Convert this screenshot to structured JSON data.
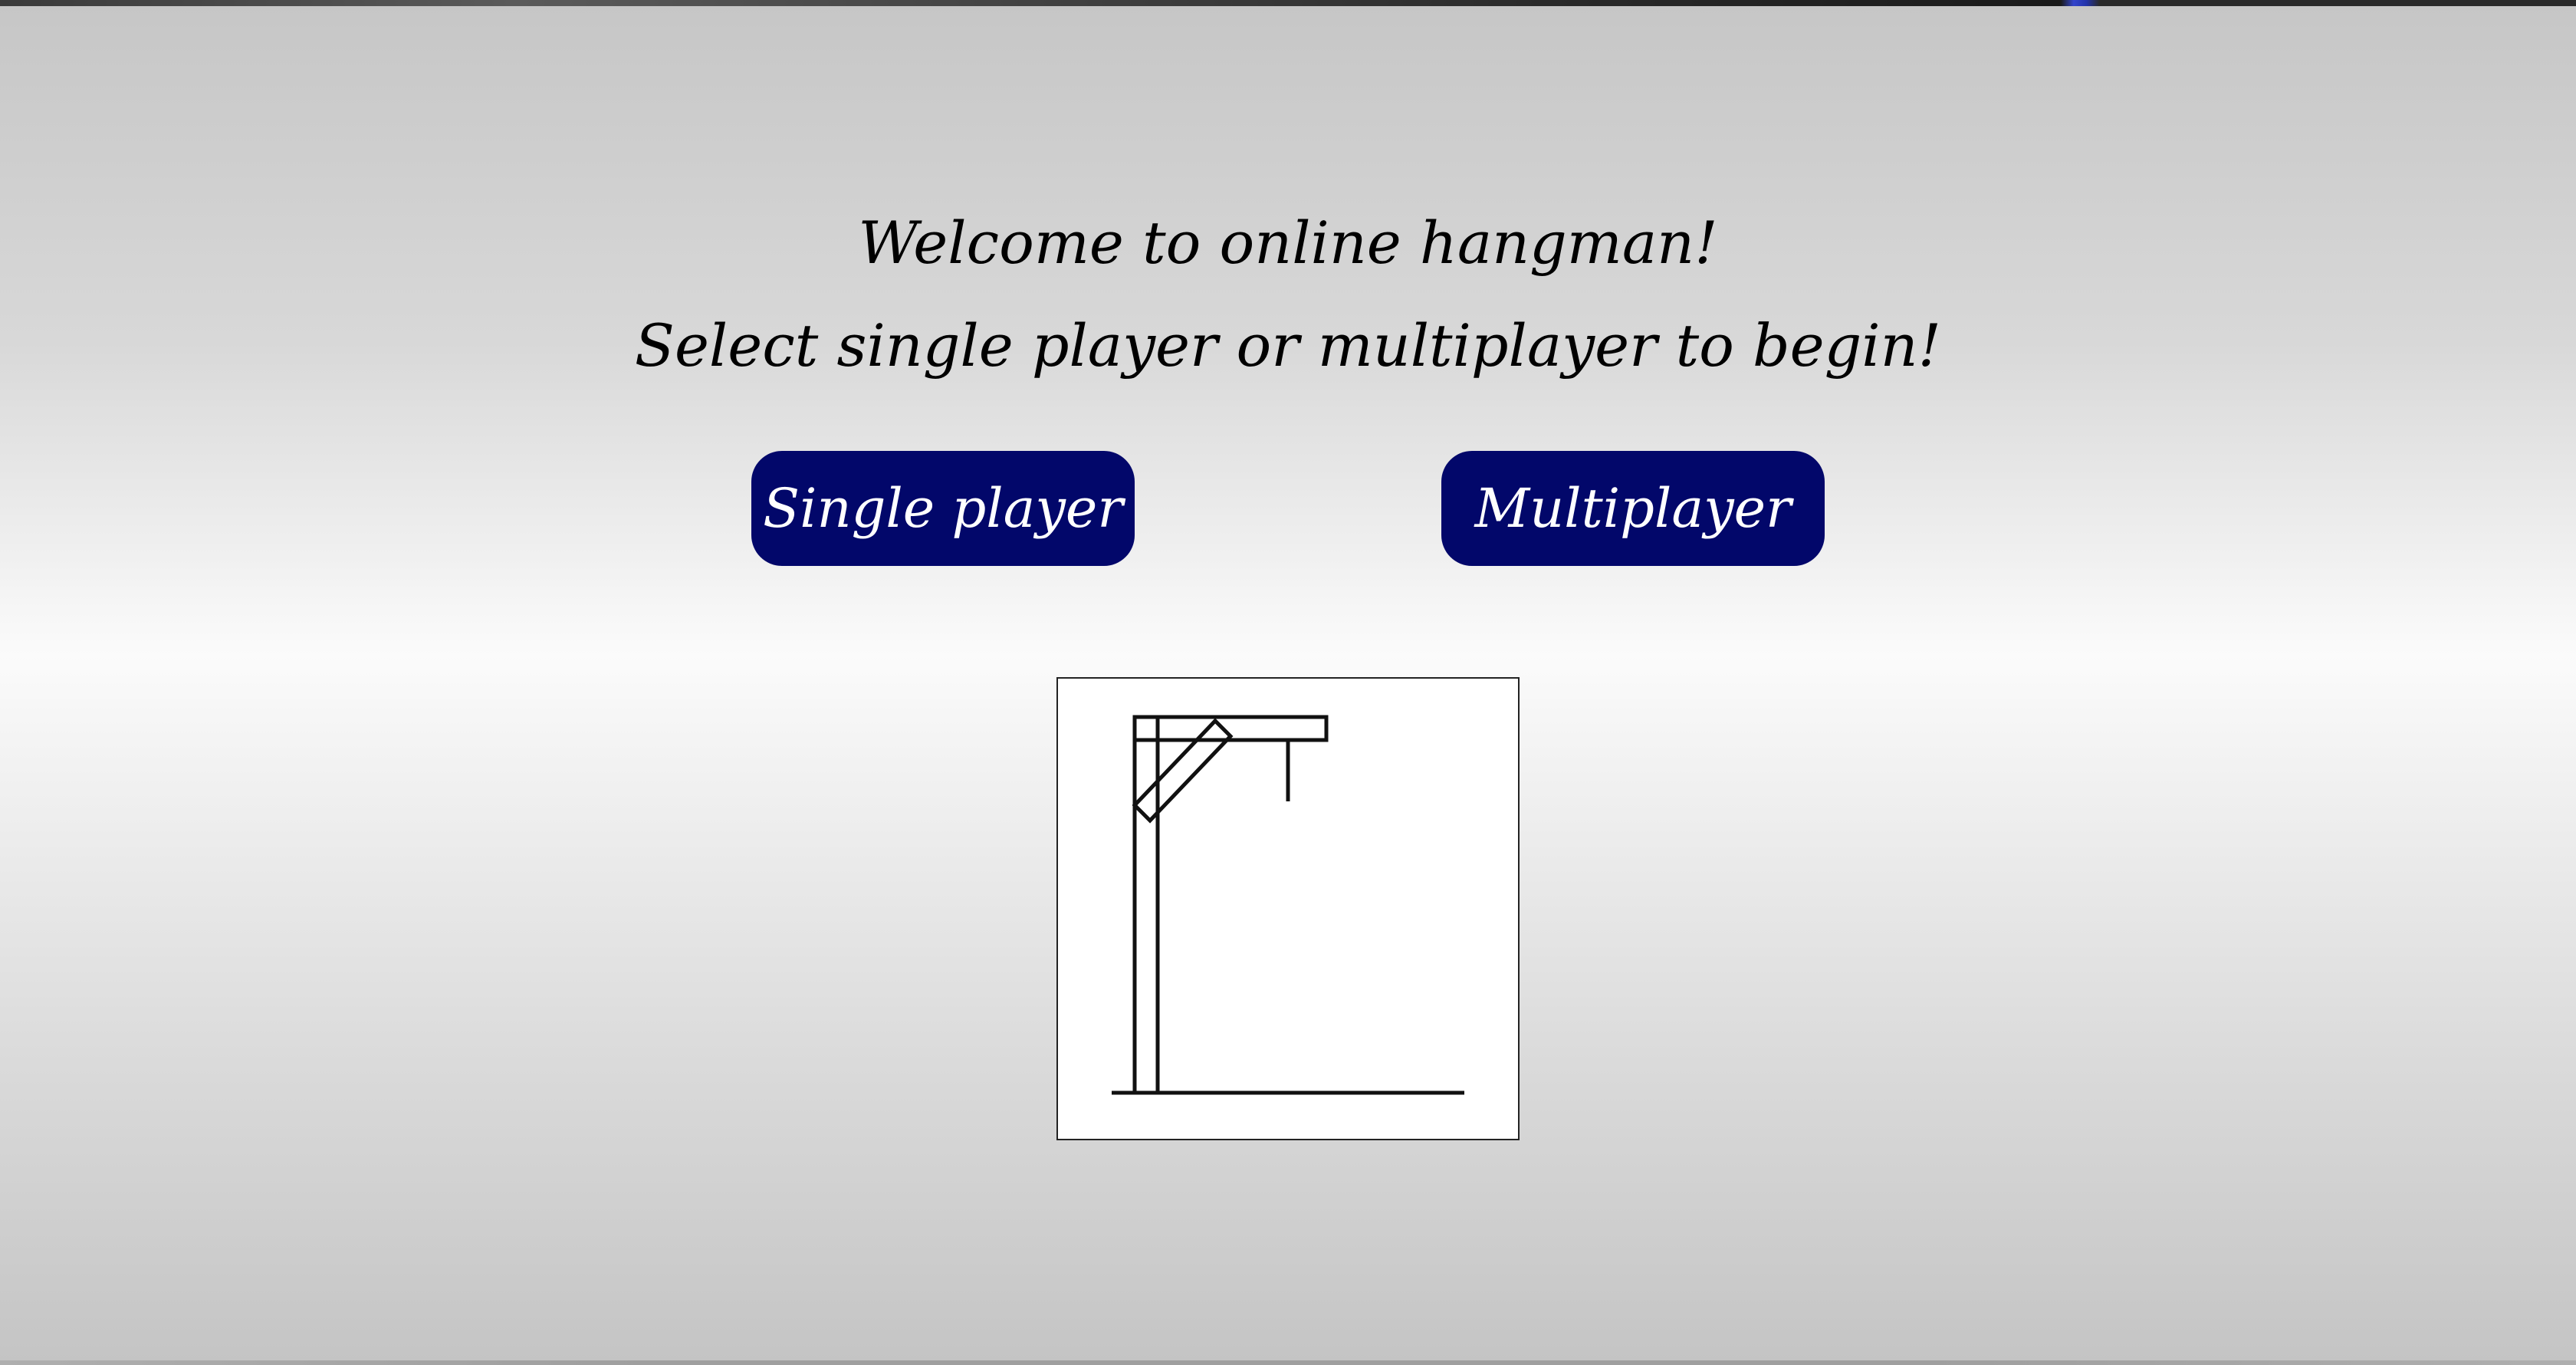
{
  "welcome": {
    "line1": "Welcome to online hangman!",
    "line2": "Select single player or multiplayer to begin!"
  },
  "buttons": {
    "single_player": "Single player",
    "multiplayer": "Multiplayer"
  },
  "colors": {
    "button_background": "#02076a",
    "button_text": "#ffffff"
  },
  "hangman": {
    "icon": "gallows-icon",
    "wrong_guesses": 0
  }
}
